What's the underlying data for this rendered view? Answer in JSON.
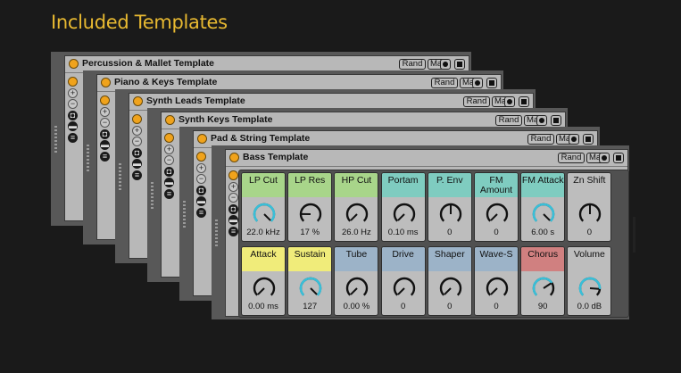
{
  "page_title": "Included Templates",
  "templates": [
    {
      "title": "Percussion & Mallet Template",
      "rand": "Rand",
      "map": "Map"
    },
    {
      "title": "Piano & Keys Template",
      "rand": "Rand",
      "map": "Map"
    },
    {
      "title": "Synth Leads Template",
      "rand": "Rand",
      "map": "Map"
    },
    {
      "title": "Synth Keys Template",
      "rand": "Rand",
      "map": "Map"
    },
    {
      "title": "Pad & String Template",
      "rand": "Rand",
      "map": "Map"
    },
    {
      "title": "Bass Template",
      "rand": "Rand",
      "map": "Map"
    }
  ],
  "macros": [
    {
      "label": "LP Cut",
      "value": "22.0 kHz",
      "color": "#a8d58a",
      "knob_color": "#39bfd8",
      "level": 1.0
    },
    {
      "label": "LP Res",
      "value": "17 %",
      "color": "#a8d58a",
      "knob_color": "#111111",
      "level": 0.17
    },
    {
      "label": "HP Cut",
      "value": "26.0 Hz",
      "color": "#a8d58a",
      "knob_color": "#111111",
      "level": 0.0
    },
    {
      "label": "Portam",
      "value": "0.10 ms",
      "color": "#7fccc0",
      "knob_color": "#111111",
      "level": 0.0
    },
    {
      "label": "P. Env",
      "value": "0",
      "color": "#7fccc0",
      "knob_color": "#111111",
      "level": 0.5
    },
    {
      "label": "FM Amount",
      "value": "0",
      "color": "#7fccc0",
      "knob_color": "#111111",
      "level": 0.0
    },
    {
      "label": "FM Attack",
      "value": "6.00 s",
      "color": "#7fccc0",
      "knob_color": "#39bfd8",
      "level": 1.0
    },
    {
      "label": "Zn Shift",
      "value": "0",
      "color": "#bdbdbd",
      "knob_color": "#111111",
      "level": 0.5
    },
    {
      "label": "Attack",
      "value": "0.00 ms",
      "color": "#f0ec7a",
      "knob_color": "#111111",
      "level": 0.0
    },
    {
      "label": "Sustain",
      "value": "127",
      "color": "#f0ec7a",
      "knob_color": "#39bfd8",
      "level": 1.0
    },
    {
      "label": "Tube",
      "value": "0.00 %",
      "color": "#9cb3c8",
      "knob_color": "#111111",
      "level": 0.0
    },
    {
      "label": "Drive",
      "value": "0",
      "color": "#9cb3c8",
      "knob_color": "#111111",
      "level": 0.0
    },
    {
      "label": "Shaper",
      "value": "0",
      "color": "#9cb3c8",
      "knob_color": "#111111",
      "level": 0.0
    },
    {
      "label": "Wave-S",
      "value": "0",
      "color": "#9cb3c8",
      "knob_color": "#111111",
      "level": 0.0
    },
    {
      "label": "Chorus",
      "value": "90",
      "color": "#d08080",
      "knob_color": "#39bfd8",
      "level": 0.71
    },
    {
      "label": "Volume",
      "value": "0.0 dB",
      "color": "#bdbdbd",
      "knob_color": "#39bfd8",
      "level": 0.85
    }
  ],
  "colors": {
    "accent": "#f0a31c",
    "title": "#e8b931",
    "active_knob": "#39bfd8"
  }
}
